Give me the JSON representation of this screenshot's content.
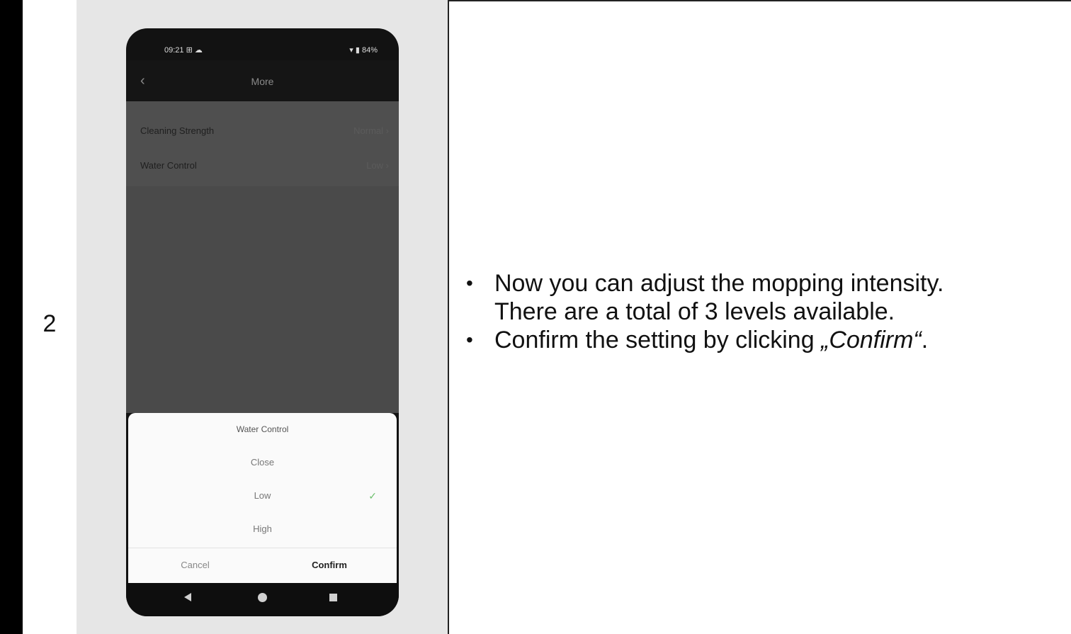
{
  "step": {
    "number": "2"
  },
  "phone": {
    "status": {
      "time": "09:21 ⊞ ☁",
      "right": "▾ ▮ 84%"
    },
    "appbar": {
      "back": "‹",
      "title": "More"
    },
    "settings": [
      {
        "label": "Cleaning Strength",
        "value": "Normal ›"
      },
      {
        "label": "Water Control",
        "value": "Low ›"
      }
    ],
    "sheet": {
      "title": "Water Control",
      "options": [
        "Close",
        "Low",
        "High"
      ],
      "selected": "Low",
      "check": "✓",
      "cancel": "Cancel",
      "confirm": "Confirm"
    }
  },
  "instructions": {
    "bullet1_line1": "Now you can adjust the mopping intensity.",
    "bullet1_line2": "There are a total of  3 levels available.",
    "bullet2_prefix": "Confirm the setting by clicking ",
    "bullet2_emph": "„Confirm“",
    "bullet2_suffix": "."
  },
  "colors": {
    "check": "#6ec06e",
    "phone_body": "#121212",
    "overlay": "#4a4a4a"
  },
  "icons": {
    "back": "back-arrow-icon",
    "check": "checkmark-icon",
    "nav": [
      "nav-back-icon",
      "nav-home-icon",
      "nav-recents-icon"
    ]
  }
}
